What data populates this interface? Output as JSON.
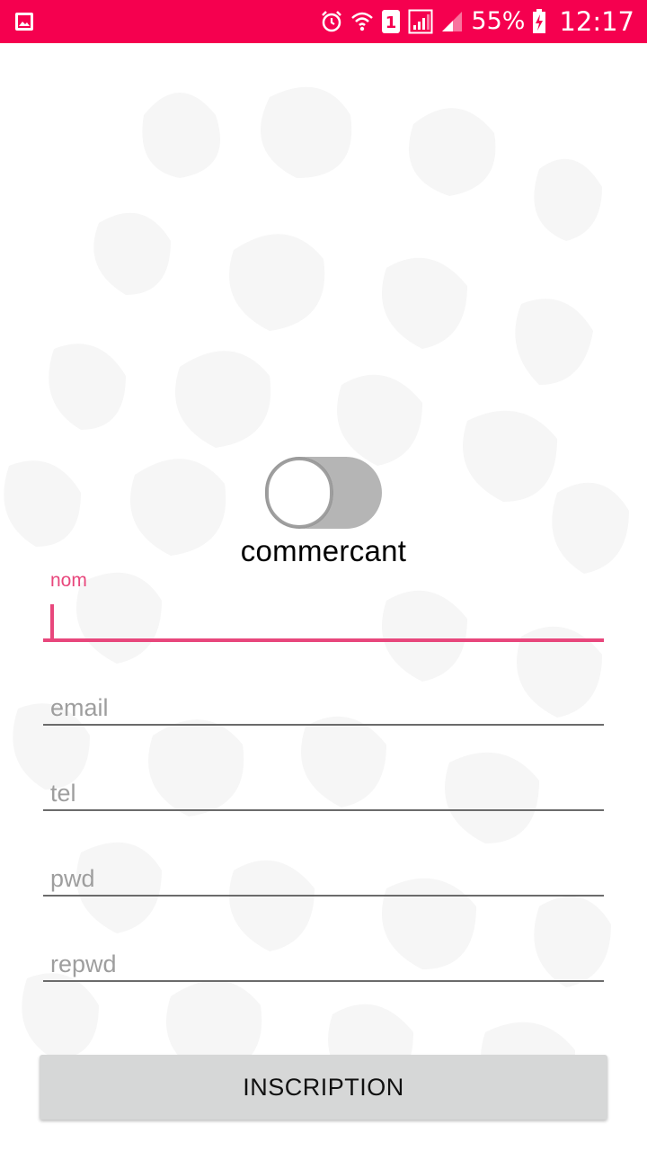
{
  "status_bar": {
    "battery": "55%",
    "time": "12:17",
    "sim_slot": "1",
    "background_color": "#f5004f",
    "icons": [
      "gallery-icon",
      "alarm-icon",
      "wifi-icon",
      "sim-icon",
      "signal-icon",
      "signal-icon",
      "battery-charging-icon"
    ]
  },
  "toggle": {
    "label": "commercant",
    "checked": false
  },
  "form": {
    "nom": {
      "label": "nom",
      "value": "",
      "focused": true
    },
    "email": {
      "placeholder": "email",
      "value": ""
    },
    "tel": {
      "placeholder": "tel",
      "value": ""
    },
    "pwd": {
      "placeholder": "pwd",
      "value": ""
    },
    "repwd": {
      "placeholder": "repwd",
      "value": ""
    }
  },
  "submit": {
    "label": "INSCRIPTION"
  },
  "colors": {
    "accent": "#e8477c",
    "status_bar": "#f5004f",
    "button_bg": "#d6d7d7"
  }
}
